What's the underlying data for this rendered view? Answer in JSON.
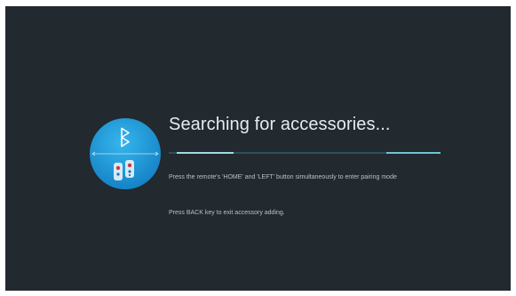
{
  "screen": {
    "title": "Searching for accessories...",
    "instructions": [
      "Press the remote's 'HOME' and 'LEFT' button simultaneously to enter pairing mode",
      "Press BACK key to exit accessory adding."
    ]
  },
  "progress": {
    "segments": [
      {
        "start": 0.03,
        "end": 0.24
      },
      {
        "start": 0.8,
        "end": 1.0
      }
    ]
  },
  "graphic": {
    "icon": "bluetooth-pairing-icon",
    "circle_color": "#1c8fcf",
    "circle_color_light": "#2eaee6"
  },
  "colors": {
    "background": "#22292f",
    "title_text": "#e6ecee",
    "instruction_text": "#b8c2c6",
    "progress_track": "#2f4f58",
    "progress_fill": "#9fdbe6"
  }
}
